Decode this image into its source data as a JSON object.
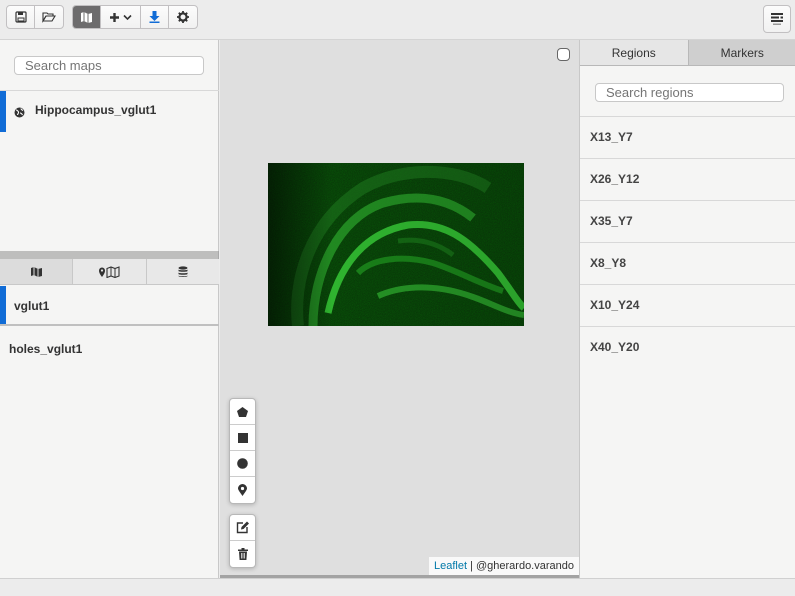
{
  "toolbar": {
    "file_buttons": [
      "save-icon",
      "folder-open-icon"
    ],
    "tool_buttons": [
      "map-icon",
      "plus-icon",
      "download-icon",
      "gear-icon"
    ],
    "layout_button": "sidebar-layout-icon"
  },
  "sidebar": {
    "maps_search_placeholder": "Search maps",
    "maps": [
      {
        "label": "Hippocampus_vglut1",
        "icon": "globe-icon",
        "selected": true
      }
    ],
    "layer_tabs": [
      "map-icon",
      "map-marker-icon",
      "database-icon"
    ],
    "layers": [
      {
        "label": "vglut1",
        "selected": true
      },
      {
        "label": "holes_vglut1",
        "selected": false
      }
    ]
  },
  "map": {
    "draw_tools": [
      "polygon-icon",
      "rectangle-icon",
      "circle-icon",
      "marker-icon"
    ],
    "edit_tools": [
      "edit-icon",
      "trash-icon"
    ],
    "attribution_link": "Leaflet",
    "attribution_text": " | @gherardo.varando"
  },
  "right_panel": {
    "tabs": [
      {
        "label": "Regions",
        "active": true
      },
      {
        "label": "Markers",
        "active": false
      }
    ],
    "search_placeholder": "Search regions",
    "regions": [
      "X13_Y7",
      "X26_Y12",
      "X35_Y7",
      "X8_Y8",
      "X10_Y24",
      "X40_Y20"
    ]
  },
  "colors": {
    "accent": "#116cd6",
    "image_green": "#1e8a1e"
  }
}
